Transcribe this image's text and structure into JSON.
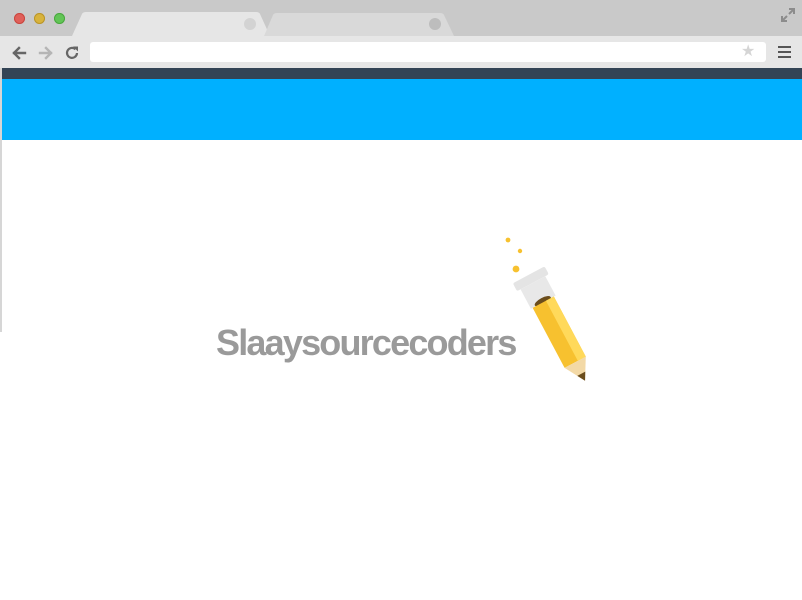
{
  "browser": {
    "tabs": [
      {
        "title": "",
        "active": true
      },
      {
        "title": "",
        "active": false
      }
    ],
    "address_bar": {
      "value": "",
      "placeholder": ""
    },
    "icons": {
      "back": "arrow-left-icon",
      "forward": "arrow-right-icon",
      "reload": "reload-icon",
      "bookmark": "star-icon",
      "menu": "hamburger-menu-icon",
      "fullscreen": "expand-icon",
      "star_glyph": "★"
    },
    "colors": {
      "tabstrip": "#c9c9c9",
      "toolbar": "#e6e6e6",
      "close": "#e0605a",
      "minimize": "#d8b33c",
      "maximize": "#62c556"
    }
  },
  "page": {
    "colors": {
      "nav_bar": "#334455",
      "banner": "#00b0ff",
      "logo_text": "#9a9a9a",
      "pencil": "#f7c12f"
    },
    "logo": {
      "text": "Slaaysourcecoders",
      "icon": "pencil-icon"
    }
  }
}
